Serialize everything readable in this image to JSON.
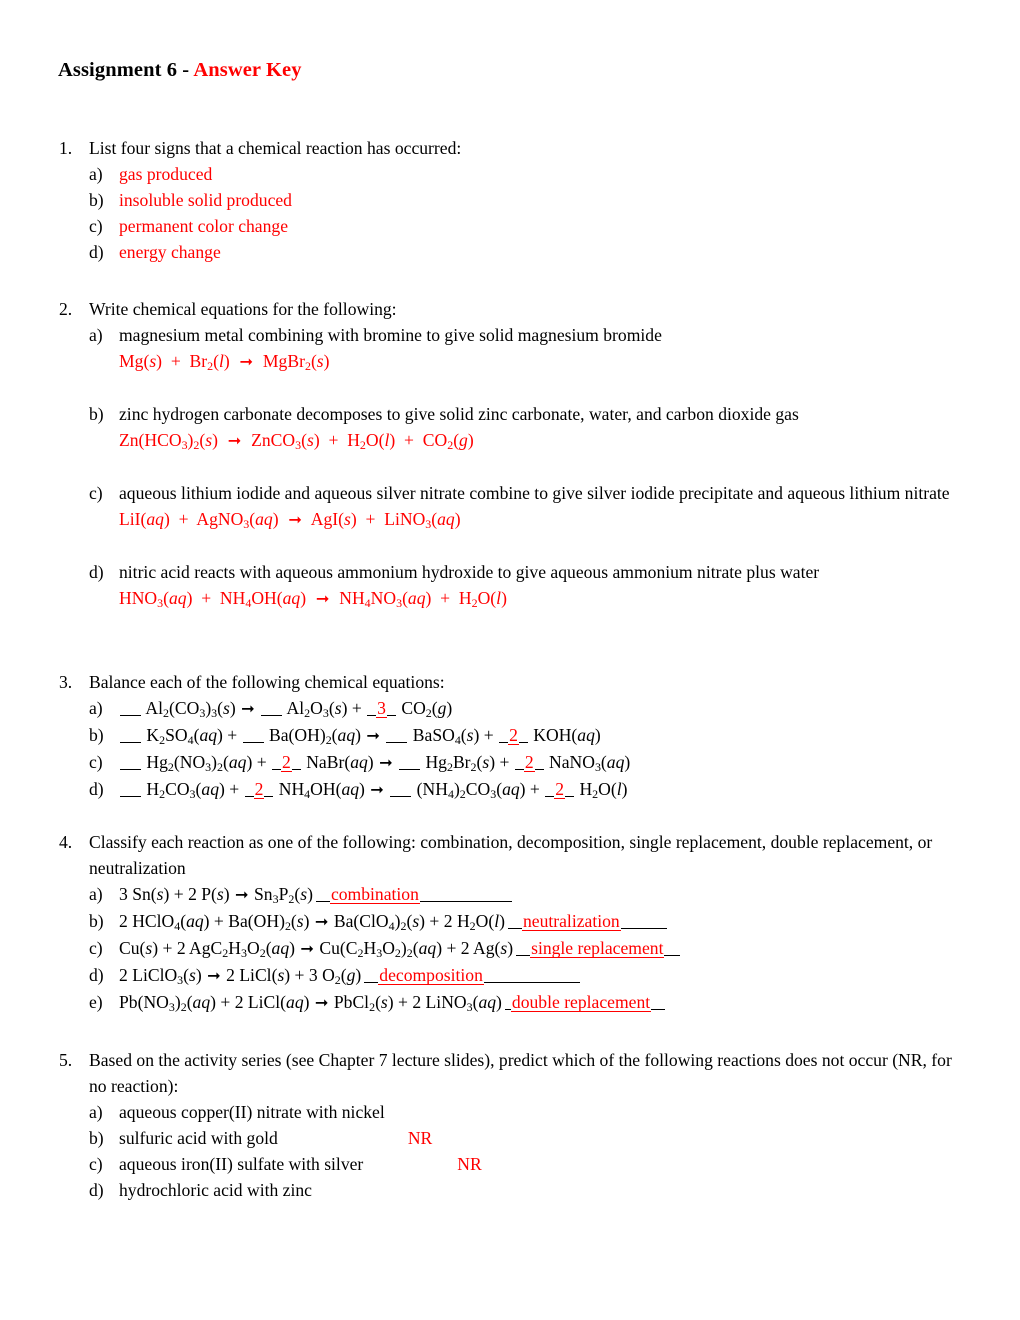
{
  "document": {
    "title_black": "Assignment 6 - ",
    "title_red": "Answer Key",
    "accent_color": "#ff0000",
    "text_color": "#000000",
    "background_color": "#ffffff"
  },
  "q1": {
    "number": "1.",
    "prompt": "List four signs that a chemical reaction has occurred:",
    "items": [
      {
        "letter": "a)",
        "answer": "gas produced"
      },
      {
        "letter": "b)",
        "answer": "insoluble solid produced"
      },
      {
        "letter": "c)",
        "answer": "permanent color change"
      },
      {
        "letter": "d)",
        "answer": "energy change"
      }
    ]
  },
  "q2": {
    "number": "2.",
    "prompt": "Write chemical equations for the following:",
    "items": [
      {
        "letter": "a)",
        "prompt": "magnesium metal combining with bromine to give solid magnesium bromide"
      },
      {
        "letter": "b)",
        "prompt": "zinc hydrogen carbonate decomposes to give solid zinc carbonate, water, and carbon dioxide gas"
      },
      {
        "letter": "c)",
        "prompt": "aqueous lithium iodide and aqueous silver nitrate combine to give silver iodide precipitate and aqueous lithium nitrate"
      },
      {
        "letter": "d)",
        "prompt": "nitric acid reacts with aqueous ammonium hydroxide to give aqueous ammonium nitrate plus water"
      }
    ],
    "equations": {
      "a": "Mg(s)  +  Br2(l)  →  MgBr2(s)",
      "b": "Zn(HCO3)2(s)  →  ZnCO3(s)  +  H2O(l)  +  CO2(g)",
      "c": "LiI(aq)  +  AgNO3(aq)  →  AgI(s)  +  LiNO3(aq)",
      "d": "HNO3(aq)  +  NH4OH(aq)  →  NH4NO3(aq)  +  H2O(l)"
    }
  },
  "q3": {
    "number": "3.",
    "prompt": "Balance each of the following chemical equations:",
    "items": [
      {
        "letter": "a)",
        "equation": "__ Al2(CO3)3(s) → __ Al2O3(s) + _3_ CO2(g)",
        "coefficients": [
          "",
          "",
          "3"
        ]
      },
      {
        "letter": "b)",
        "equation": "__ K2SO4(aq) + __ Ba(OH)2(aq) → __ BaSO4(s) + _2_ KOH(aq)",
        "coefficients": [
          "",
          "",
          "",
          "2"
        ]
      },
      {
        "letter": "c)",
        "equation": "__ Hg2(NO3)2(aq) + _2_ NaBr(aq) → __ Hg2Br2(s) + _2_ NaNO3(aq)",
        "coefficients": [
          "",
          "2",
          "",
          "2"
        ]
      },
      {
        "letter": "d)",
        "equation": "__ H2CO3(aq) + _2_ NH4OH(aq) → __ (NH4)2CO3(aq) + _2_ H2O(l)",
        "coefficients": [
          "",
          "2",
          "",
          "2"
        ]
      }
    ]
  },
  "q4": {
    "number": "4.",
    "prompt": "Classify each reaction as one of the following: combination, decomposition, single replacement, double replacement, or neutralization",
    "items": [
      {
        "letter": "a)",
        "equation": "3 Sn(s) + 2 P(s) → Sn3P2(s)",
        "answer": "combination",
        "tail": 92
      },
      {
        "letter": "b)",
        "equation": "2 HClO4(aq) + Ba(OH)2(s) → Ba(ClO4)2(s) + 2 H2O(l)",
        "answer": "neutralization",
        "tail": 46
      },
      {
        "letter": "c)",
        "equation": "Cu(s) + 2 AgC2H3O2(aq) → Cu(C2H3O2)2(aq) + 2 Ag(s)",
        "answer": "single replacement",
        "tail": 16
      },
      {
        "letter": "d)",
        "equation": "2 LiClO3(s) → 2 LiCl(s) + 3 O2(g)",
        "answer": "decomposition",
        "tail": 96
      },
      {
        "letter": "e)",
        "equation": "Pb(NO3)2(aq) + 2 LiCl(aq) → PbCl2(s) + 2 LiNO3(aq)",
        "answer": "double replacement",
        "tail": 14
      }
    ]
  },
  "q5": {
    "number": "5.",
    "prompt": "Based on the activity series (see Chapter 7 lecture slides), predict which of the following reactions does not occur (NR, for no reaction):",
    "items": [
      {
        "letter": "a)",
        "text": "aqueous copper(II) nitrate with nickel",
        "result": ""
      },
      {
        "letter": "b)",
        "text": "sulfuric acid with gold",
        "result": "NR"
      },
      {
        "letter": "c)",
        "text": "aqueous iron(II) sulfate with silver",
        "result": "NR"
      },
      {
        "letter": "d)",
        "text": "hydrochloric acid with zinc",
        "result": ""
      }
    ]
  }
}
